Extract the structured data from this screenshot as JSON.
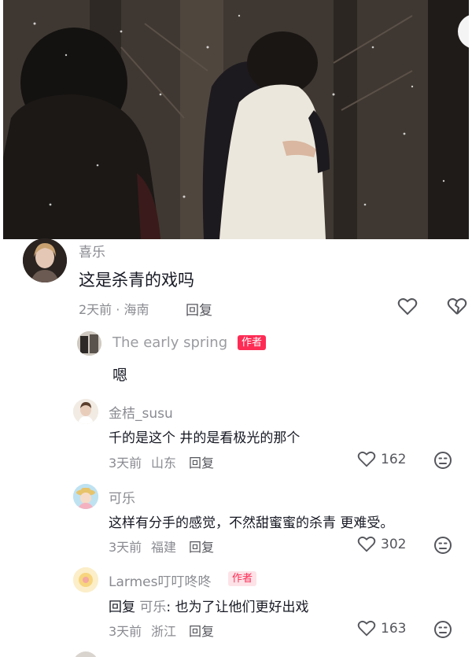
{
  "comments": [
    {
      "user": "喜乐",
      "text": "这是杀青的戏吗",
      "time": "2天前 · 海南",
      "reply_label": "回复",
      "icons": [
        "heart-outline-icon",
        "broken-heart-icon"
      ]
    },
    {
      "user": "The early spring",
      "badge": "作者",
      "text": "嗯"
    },
    {
      "user": "金桔_susu",
      "text": "千的是这个 井的是看极光的那个",
      "time": "3天前",
      "location": "山东",
      "reply_label": "回复",
      "likes": "162"
    },
    {
      "user": "可乐",
      "text": "这样有分手的感觉，不然甜蜜蜜的杀青 更难受。",
      "time": "3天前",
      "location": "福建",
      "reply_label": "回复",
      "likes": "302"
    },
    {
      "user": "Larmes叮叮咚咚",
      "badge": "作者",
      "reply_prefix": "回复",
      "reply_to": "可乐",
      "text": ": 也为了让他们更好出戏",
      "time": "3天前",
      "location": "浙江",
      "reply_label": "回复",
      "likes": "163"
    }
  ],
  "colors": {
    "author_badge": "#fe2c55",
    "name_gray": "#8a8b91",
    "text_dark": "#161823"
  }
}
